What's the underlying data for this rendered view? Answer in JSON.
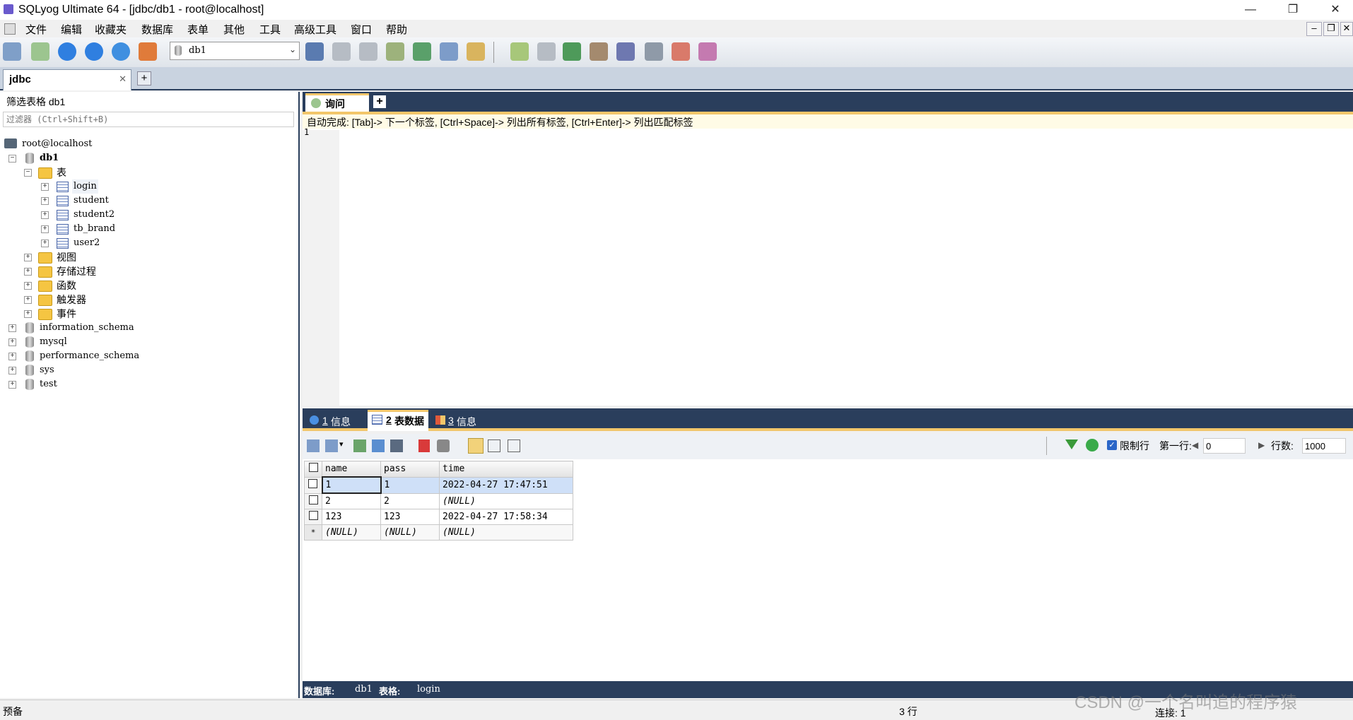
{
  "window": {
    "title": "SQLyog Ultimate 64 - [jdbc/db1 - root@localhost]"
  },
  "menu": [
    "文件",
    "编辑",
    "收藏夹",
    "数据库",
    "表单",
    "其他",
    "工具",
    "高级工具",
    "窗口",
    "帮助"
  ],
  "toolbar": {
    "db_select": "db1"
  },
  "connection_tab": {
    "label": "jdbc",
    "close": "✕",
    "add": "+"
  },
  "left": {
    "filter_label": "筛选表格 db1",
    "filter_placeholder": "过滤器 (Ctrl+Shift+B)",
    "tree": {
      "root": "root@localhost",
      "db": "db1",
      "tables_folder": "表",
      "tables": [
        "login",
        "student",
        "student2",
        "tb_brand",
        "user2"
      ],
      "folders": [
        "视图",
        "存储过程",
        "函数",
        "触发器",
        "事件"
      ],
      "other_dbs": [
        "information_schema",
        "mysql",
        "performance_schema",
        "sys",
        "test"
      ]
    }
  },
  "editor": {
    "tab_label": "询问",
    "hint": "自动完成: [Tab]-> 下一个标签, [Ctrl+Space]-> 列出所有标签, [Ctrl+Enter]-> 列出匹配标签",
    "line1": "1"
  },
  "results": {
    "tabs": [
      {
        "num": "1",
        "label": "信息"
      },
      {
        "num": "2",
        "label": "表数据"
      },
      {
        "num": "3",
        "label": "信息"
      }
    ],
    "limit_label": "限制行",
    "first_row_label": "第一行:",
    "first_row_value": "0",
    "rows_label": "行数:",
    "rows_value": "1000",
    "columns": [
      "name",
      "pass",
      "time"
    ],
    "rows": [
      [
        "1",
        "1",
        "2022-04-27 17:47:51"
      ],
      [
        "2",
        "2",
        "(NULL)"
      ],
      [
        "123",
        "123",
        "2022-04-27 17:58:34"
      ],
      [
        "(NULL)",
        "(NULL)",
        "(NULL)"
      ]
    ],
    "new_row_marker": "*",
    "info_db_label": "数据库:",
    "info_db": "db1",
    "info_table_label": "表格:",
    "info_table": "login"
  },
  "status": {
    "left": "预备",
    "rows": "3 行",
    "conn": "连接: 1"
  },
  "watermark": "CSDN @一个名叫追的程序猿"
}
